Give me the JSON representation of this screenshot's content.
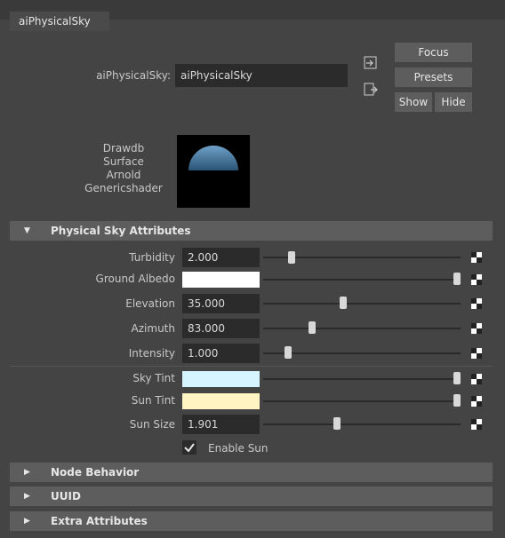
{
  "tab": {
    "label": "aiPhysicalSky"
  },
  "header": {
    "node_label": "aiPhysicalSky:",
    "node_value": "aiPhysicalSky",
    "buttons": {
      "focus": "Focus",
      "presets": "Presets",
      "show": "Show",
      "hide": "Hide"
    }
  },
  "swatch": {
    "labels": [
      "Drawdb",
      "Surface",
      "Arnold",
      "Genericshader"
    ]
  },
  "sections": {
    "physical_sky": "Physical Sky Attributes",
    "node_behavior": "Node Behavior",
    "uuid": "UUID",
    "extra": "Extra Attributes"
  },
  "attributes": {
    "turbidity": {
      "label": "Turbidity",
      "value": "2.000",
      "slider": 0.13
    },
    "ground_albedo": {
      "label": "Ground Albedo",
      "color": "#ffffff",
      "slider": 1.0
    },
    "elevation": {
      "label": "Elevation",
      "value": "35.000",
      "slider": 0.4
    },
    "azimuth": {
      "label": "Azimuth",
      "value": "83.000",
      "slider": 0.24
    },
    "intensity": {
      "label": "Intensity",
      "value": "1.000",
      "slider": 0.11
    },
    "sky_tint": {
      "label": "Sky Tint",
      "color": "#d6f4ff",
      "slider": 1.0
    },
    "sun_tint": {
      "label": "Sun Tint",
      "color": "#fff4c2",
      "slider": 1.0
    },
    "sun_size": {
      "label": "Sun Size",
      "value": "1.901",
      "slider": 0.37
    }
  },
  "enable_sun": {
    "label": "Enable Sun",
    "checked": true
  },
  "colors": {
    "background": "#444444",
    "field": "#2b2b2b",
    "button": "#5d5d5d",
    "section": "#5d5d5d",
    "sky_gradient_top": "#6fa0c8",
    "sky_gradient_bottom": "#2a5474"
  }
}
